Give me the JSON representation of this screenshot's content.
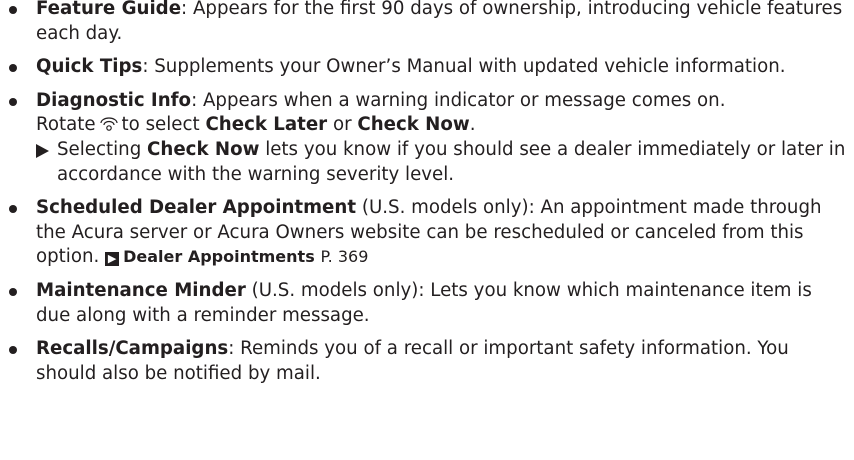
{
  "items": [
    {
      "title": "Feature Guide",
      "text": ": Appears for the first 90 days of ownership, introducing vehicle features each day."
    },
    {
      "title": "Quick Tips",
      "text": ": Supplements your Owner’s Manual with updated vehicle information."
    },
    {
      "title": "Diagnostic Info",
      "text": ": Appears when a warning indicator or message comes on.",
      "rotate": "Rotate",
      "icon": "selector-dial-icon",
      "to_select": "to select",
      "opt1": "Check Later",
      "or": "or",
      "opt2": "Check Now",
      "end": ".",
      "note_pre": "Selecting",
      "note_bold": "Check Now",
      "note_post": "lets you know if you should see a dealer immediately or later in accordance with the warning severity level."
    },
    {
      "title": "Scheduled Dealer Appointment",
      "qualifier": "(U.S. models only)",
      "text": ": An appointment made through the Acura server or Acura Owners website can be rescheduled or canceled from this option.",
      "xref_icon": "cross-reference-arrow-icon",
      "xref_title": "Dealer Appointments",
      "xref_page": "P. 369"
    },
    {
      "title": "Maintenance Minder",
      "qualifier": "(U.S. models only)",
      "text": ": Lets you know which maintenance item is due along with a reminder message."
    },
    {
      "title": "Recalls/Campaigns",
      "text": ": Reminds you of a recall or important safety information. You should also be notified by mail."
    }
  ]
}
